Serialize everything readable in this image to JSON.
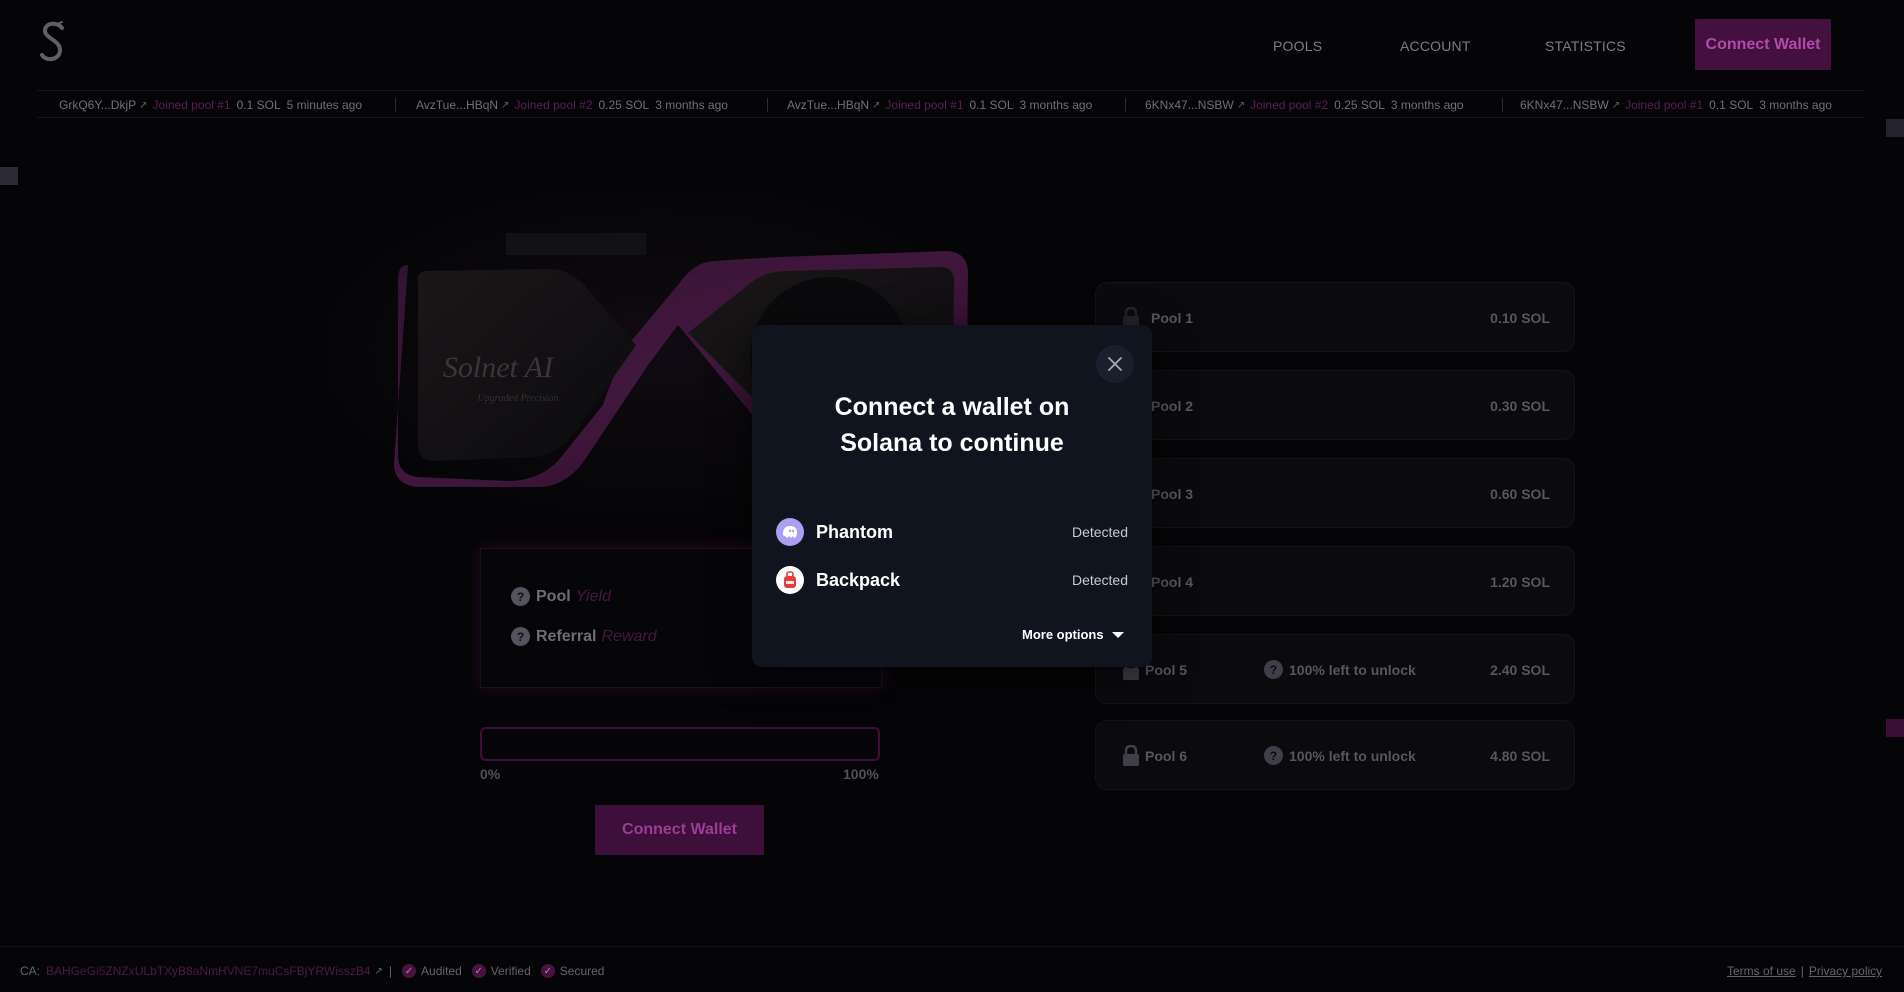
{
  "header": {
    "nav": [
      "POOLS",
      "ACCOUNT",
      "STATISTICS"
    ],
    "connect_label": "Connect Wallet"
  },
  "ticker": [
    {
      "addr": "GrkQ6Y...DkjP",
      "action": "Joined pool #1",
      "amount": "0.1 SOL",
      "time": "5 minutes ago"
    },
    {
      "addr": "AvzTue...HBqN",
      "action": "Joined pool #2",
      "amount": "0.25 SOL",
      "time": "3 months ago"
    },
    {
      "addr": "AvzTue...HBqN",
      "action": "Joined pool #1",
      "amount": "0.1 SOL",
      "time": "3 months ago"
    },
    {
      "addr": "6KNx47...NSBW",
      "action": "Joined pool #2",
      "amount": "0.25 SOL",
      "time": "3 months ago"
    },
    {
      "addr": "6KNx47...NSBW",
      "action": "Joined pool #1",
      "amount": "0.1 SOL",
      "time": "3 months ago"
    }
  ],
  "gpu": {
    "brand": "Solnet AI",
    "tagline": "Upgraded Precision"
  },
  "info": {
    "pool_label": "Pool",
    "pool_accent": "Yield",
    "referral_label": "Referral",
    "referral_accent": "Reward"
  },
  "progress": {
    "value": 0,
    "min_label": "0%",
    "max_label": "100%"
  },
  "main_connect_label": "Connect Wallet",
  "pools": [
    {
      "name": "Pool 1",
      "value": "0.10 SOL",
      "unlock": ""
    },
    {
      "name": "Pool 2",
      "value": "0.30 SOL",
      "unlock": ""
    },
    {
      "name": "Pool 3",
      "value": "0.60 SOL",
      "unlock": ""
    },
    {
      "name": "Pool 4",
      "value": "1.20 SOL",
      "unlock": ""
    },
    {
      "name": "Pool 5",
      "value": "2.40 SOL",
      "unlock": "100% left to unlock"
    },
    {
      "name": "Pool 6",
      "value": "4.80 SOL",
      "unlock": "100% left to unlock"
    }
  ],
  "footer": {
    "ca_label": "CA:",
    "ca_value": "BAHGeGi5ZNZxULbTXyB8aNmHVNE7muCsFBjYRWisszB4",
    "sep": "|",
    "badges": [
      "Audited",
      "Verified",
      "Secured"
    ],
    "terms": "Terms of use",
    "privacy": "Privacy policy",
    "link_sep": "|"
  },
  "modal": {
    "title": "Connect a wallet on\nSolana to continue",
    "wallets": [
      {
        "name": "Phantom",
        "status": "Detected"
      },
      {
        "name": "Backpack",
        "status": "Detected"
      }
    ],
    "more_options": "More options"
  },
  "colors": {
    "accent": "#8c1f86",
    "accent_dim": "#43103f",
    "modal_bg": "#10141f",
    "phantom": "#ab9ff2",
    "backpack": "#e33e3f"
  }
}
